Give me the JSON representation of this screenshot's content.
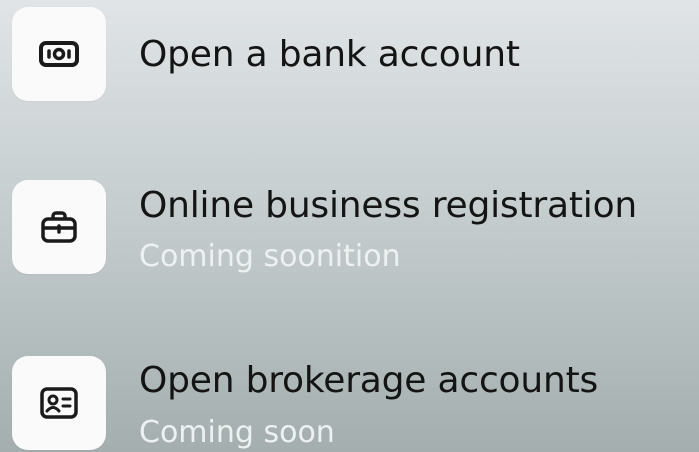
{
  "features": [
    {
      "title": "Open a bank account",
      "icon": "banknote-icon"
    },
    {
      "title": "Online business registration",
      "subtitle": "Coming soonition",
      "icon": "briefcase-icon"
    },
    {
      "title": "Open brokerage accounts",
      "subtitle": "Coming soon",
      "icon": "id-card-icon"
    }
  ],
  "colors": {
    "title": "#141414",
    "subtitle": "#eef1f1",
    "tile": "#fafafa",
    "icon": "#1a1a1a"
  }
}
